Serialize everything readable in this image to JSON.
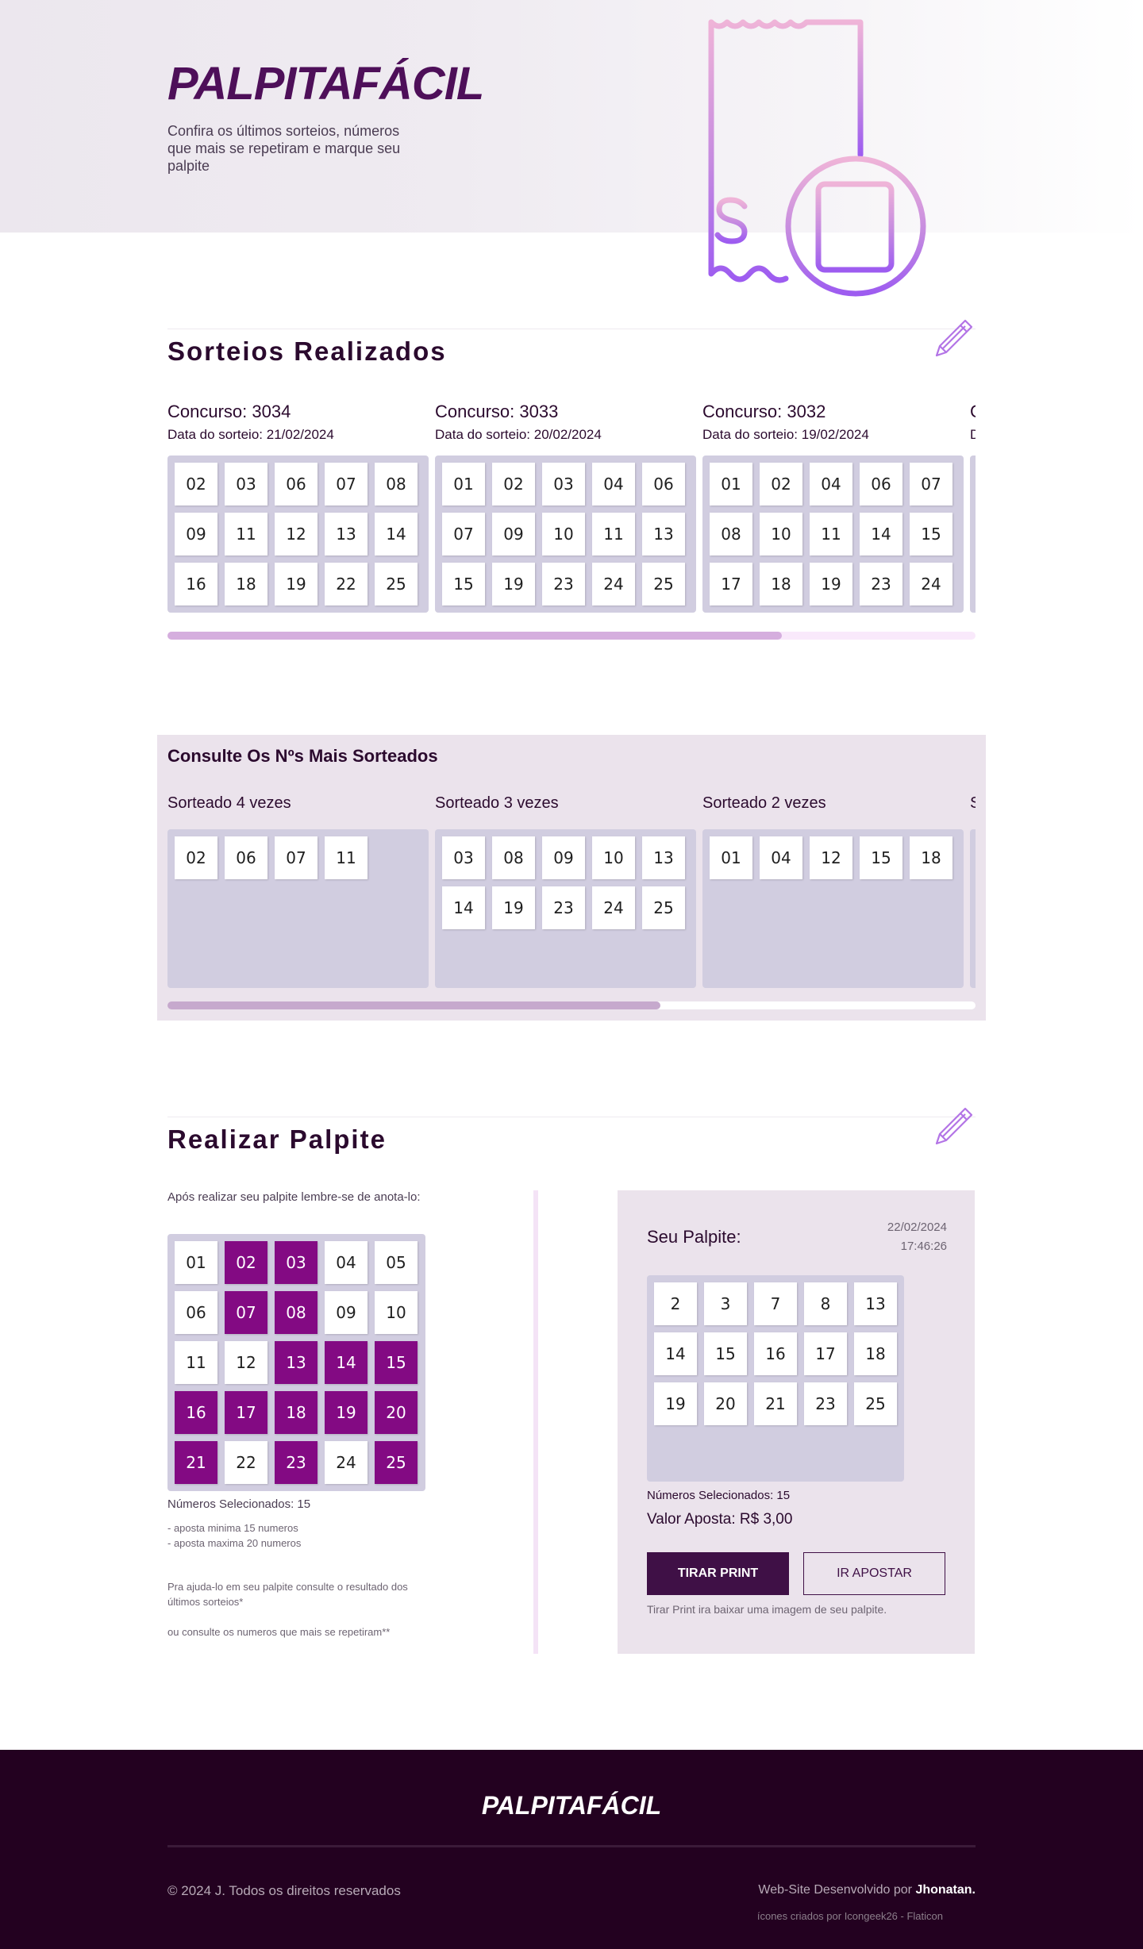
{
  "hero": {
    "brand": "PALPITAFÁCIL",
    "subtitle": "Confira os últimos sorteios, números que mais se repetiram e marque seu palpite"
  },
  "draws_section": {
    "title": "Sorteios Realizados",
    "cards": [
      {
        "title": "Concurso: 3034",
        "date": "Data do sorteio: 21/02/2024",
        "numbers": [
          "02",
          "03",
          "06",
          "07",
          "08",
          "09",
          "11",
          "12",
          "13",
          "14",
          "16",
          "18",
          "19",
          "22",
          "25"
        ]
      },
      {
        "title": "Concurso: 3033",
        "date": "Data do sorteio: 20/02/2024",
        "numbers": [
          "01",
          "02",
          "03",
          "04",
          "06",
          "07",
          "09",
          "10",
          "11",
          "13",
          "15",
          "19",
          "23",
          "24",
          "25"
        ]
      },
      {
        "title": "Concurso: 3032",
        "date": "Data do sorteio: 19/02/2024",
        "numbers": [
          "01",
          "02",
          "04",
          "06",
          "07",
          "08",
          "10",
          "11",
          "14",
          "15",
          "17",
          "18",
          "19",
          "23",
          "24"
        ]
      },
      {
        "title": "C",
        "date": "D",
        "numbers": []
      }
    ],
    "scroll_progress": 0.76
  },
  "most_drawn": {
    "title": "Consulte Os Nºs Mais Sorteados",
    "groups": [
      {
        "label": "Sorteado 4 vezes",
        "numbers": [
          "02",
          "06",
          "07",
          "11"
        ]
      },
      {
        "label": "Sorteado 3 vezes",
        "numbers": [
          "03",
          "08",
          "09",
          "10",
          "13",
          "14",
          "19",
          "23",
          "24",
          "25"
        ]
      },
      {
        "label": "Sorteado 2 vezes",
        "numbers": [
          "01",
          "04",
          "12",
          "15",
          "18"
        ]
      },
      {
        "label": "S",
        "numbers": []
      }
    ],
    "scroll_progress": 0.61
  },
  "guess_section": {
    "title": "Realizar Palpite",
    "note": "Após realizar seu palpite lembre-se de anota-lo:",
    "picker": [
      {
        "n": "01",
        "sel": false
      },
      {
        "n": "02",
        "sel": true
      },
      {
        "n": "03",
        "sel": true
      },
      {
        "n": "04",
        "sel": false
      },
      {
        "n": "05",
        "sel": false
      },
      {
        "n": "06",
        "sel": false
      },
      {
        "n": "07",
        "sel": true
      },
      {
        "n": "08",
        "sel": true
      },
      {
        "n": "09",
        "sel": false
      },
      {
        "n": "10",
        "sel": false
      },
      {
        "n": "11",
        "sel": false
      },
      {
        "n": "12",
        "sel": false
      },
      {
        "n": "13",
        "sel": true
      },
      {
        "n": "14",
        "sel": true
      },
      {
        "n": "15",
        "sel": true
      },
      {
        "n": "16",
        "sel": true
      },
      {
        "n": "17",
        "sel": true
      },
      {
        "n": "18",
        "sel": true
      },
      {
        "n": "19",
        "sel": true
      },
      {
        "n": "20",
        "sel": true
      },
      {
        "n": "21",
        "sel": true
      },
      {
        "n": "22",
        "sel": false
      },
      {
        "n": "23",
        "sel": true
      },
      {
        "n": "24",
        "sel": false
      },
      {
        "n": "25",
        "sel": true
      }
    ],
    "selected_count": "Números Selecionados: 15",
    "rule_min": "- aposta minima 15 numeros",
    "rule_max": "- aposta maxima 20 numeros",
    "help_1": "Pra ajuda-lo em seu palpite consulte o resultado dos últimos sorteios*",
    "help_2": "ou consulte os numeros que mais se repetiram**"
  },
  "ticket": {
    "title": "Seu Palpite:",
    "date": "22/02/2024",
    "time": "17:46:26",
    "numbers": [
      "2",
      "3",
      "7",
      "8",
      "13",
      "14",
      "15",
      "16",
      "17",
      "18",
      "19",
      "20",
      "21",
      "23",
      "25"
    ],
    "selected_count": "Números Selecionados: 15",
    "bet_value": "Valor Aposta: R$ 3,00",
    "print_label": "TIRAR PRINT",
    "bet_label": "IR APOSTAR",
    "hint": "Tirar Print ira baixar uma imagem de seu palpite."
  },
  "footer": {
    "brand": "PALPITAFÁCIL",
    "copyright": "© 2024 J. Todos os direitos reservados",
    "dev_prefix": "Web-Site Desenvolvido por ",
    "dev_name": "Jhonatan.",
    "icons_credit": "ícones criados por Icongeek26 - Flaticon"
  },
  "colors": {
    "brand_purple": "#4e0f59",
    "selected_number": "#830a83",
    "grid_bg": "#d1cde0",
    "footer_bg": "#230120"
  }
}
